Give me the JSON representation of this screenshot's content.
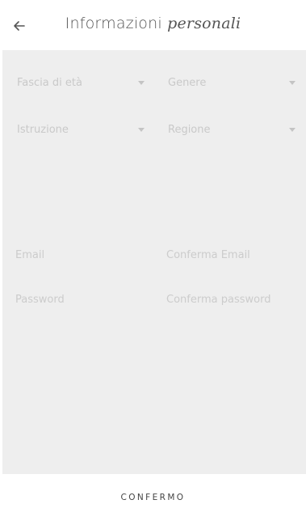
{
  "header": {
    "back_icon": "arrow-left-icon",
    "title_main": "Informazioni ",
    "title_accent": "personali"
  },
  "form": {
    "selects": {
      "age_range": {
        "placeholder": "Fascia di età",
        "icon": "caret-down-icon"
      },
      "gender": {
        "placeholder": "Genere",
        "icon": "caret-down-icon"
      },
      "education": {
        "placeholder": "Istruzione",
        "icon": "caret-down-icon"
      },
      "region": {
        "placeholder": "Regione",
        "icon": "caret-down-icon"
      }
    },
    "inputs": {
      "email": {
        "placeholder": "Email"
      },
      "confirm_email": {
        "placeholder": "Conferma Email"
      },
      "password": {
        "placeholder": "Password"
      },
      "confirm_password": {
        "placeholder": "Conferma password"
      }
    }
  },
  "footer": {
    "confirm_label": "CONFERMO"
  },
  "colors": {
    "form_background": "#eeeeee",
    "placeholder_text": "#c9c9c9",
    "title_text": "#555555"
  }
}
